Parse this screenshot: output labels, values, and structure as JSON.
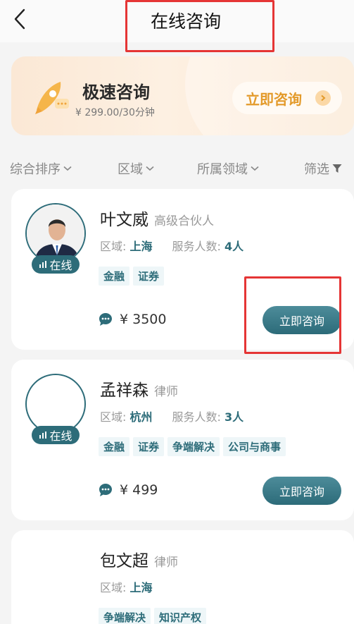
{
  "header": {
    "title": "在线咨询"
  },
  "banner": {
    "title": "极速咨询",
    "price": "¥ 299.00/30分钟",
    "button_label": "立即咨询"
  },
  "filters": [
    {
      "label": "综合排序"
    },
    {
      "label": "区域"
    },
    {
      "label": "所属领域"
    },
    {
      "label": "筛选"
    }
  ],
  "lawyers": [
    {
      "name": "叶文威",
      "role": "高级合伙人",
      "online_label": "在线",
      "region_label": "区域:",
      "region": "上海",
      "served_label": "服务人数:",
      "served": "4人",
      "tags": [
        "金融",
        "证券"
      ],
      "price": "¥ 3500",
      "button_label": "立即咨询"
    },
    {
      "name": "孟祥森",
      "role": "律师",
      "online_label": "在线",
      "region_label": "区域:",
      "region": "杭州",
      "served_label": "服务人数:",
      "served": "3人",
      "tags": [
        "金融",
        "证券",
        "争端解决",
        "公司与商事"
      ],
      "price": "¥ 499",
      "button_label": "立即咨询"
    },
    {
      "name": "包文超",
      "role": "律师",
      "region_label": "区域:",
      "region": "上海",
      "tags": [
        "争端解决",
        "知识产权"
      ]
    }
  ],
  "colors": {
    "accent": "#2d6c79",
    "banner_accent": "#e39a2a",
    "highlight": "#e53535"
  }
}
